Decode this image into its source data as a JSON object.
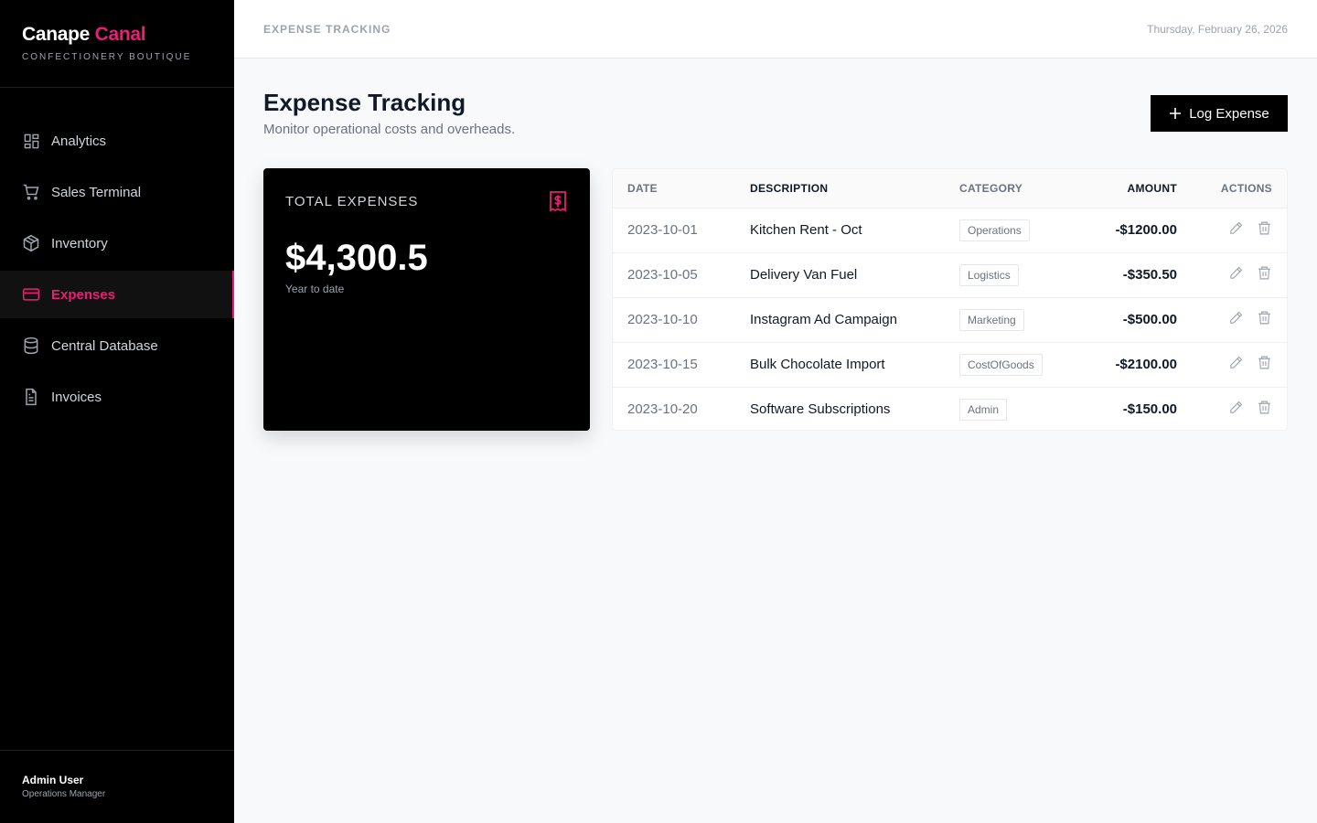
{
  "brand": {
    "name_main": "Canape",
    "name_accent": "Canal",
    "tagline": "CONFECTIONERY BOUTIQUE"
  },
  "nav": [
    {
      "label": "Analytics",
      "icon": "dashboard-icon",
      "active": false
    },
    {
      "label": "Sales Terminal",
      "icon": "cart-icon",
      "active": false
    },
    {
      "label": "Inventory",
      "icon": "package-icon",
      "active": false
    },
    {
      "label": "Expenses",
      "icon": "credit-card-icon",
      "active": true
    },
    {
      "label": "Central Database",
      "icon": "database-icon",
      "active": false
    },
    {
      "label": "Invoices",
      "icon": "document-icon",
      "active": false
    }
  ],
  "user": {
    "name": "Admin User",
    "role": "Operations Manager"
  },
  "topbar": {
    "breadcrumb": "EXPENSE TRACKING",
    "date": "Thursday, February 26, 2026"
  },
  "page": {
    "title": "Expense Tracking",
    "subtitle": "Monitor operational costs and overheads.",
    "log_button": "Log Expense"
  },
  "summary": {
    "label": "TOTAL EXPENSES",
    "value": "$4,300.5",
    "caption": "Year to date",
    "icon": "receipt-dollar-icon"
  },
  "table": {
    "headers": {
      "date": "DATE",
      "description": "DESCRIPTION",
      "category": "CATEGORY",
      "amount": "AMOUNT",
      "actions": "ACTIONS"
    },
    "rows": [
      {
        "date": "2023-10-01",
        "description": "Kitchen Rent - Oct",
        "category": "Operations",
        "amount": "-$1200.00"
      },
      {
        "date": "2023-10-05",
        "description": "Delivery Van Fuel",
        "category": "Logistics",
        "amount": "-$350.50"
      },
      {
        "date": "2023-10-10",
        "description": "Instagram Ad Campaign",
        "category": "Marketing",
        "amount": "-$500.00"
      },
      {
        "date": "2023-10-15",
        "description": "Bulk Chocolate Import",
        "category": "CostOfGoods",
        "amount": "-$2100.00"
      },
      {
        "date": "2023-10-20",
        "description": "Software Subscriptions",
        "category": "Admin",
        "amount": "-$150.00"
      }
    ]
  },
  "colors": {
    "accent": "#ec1c77",
    "sidebar_bg": "#000000",
    "page_bg": "#f8f9fb"
  }
}
